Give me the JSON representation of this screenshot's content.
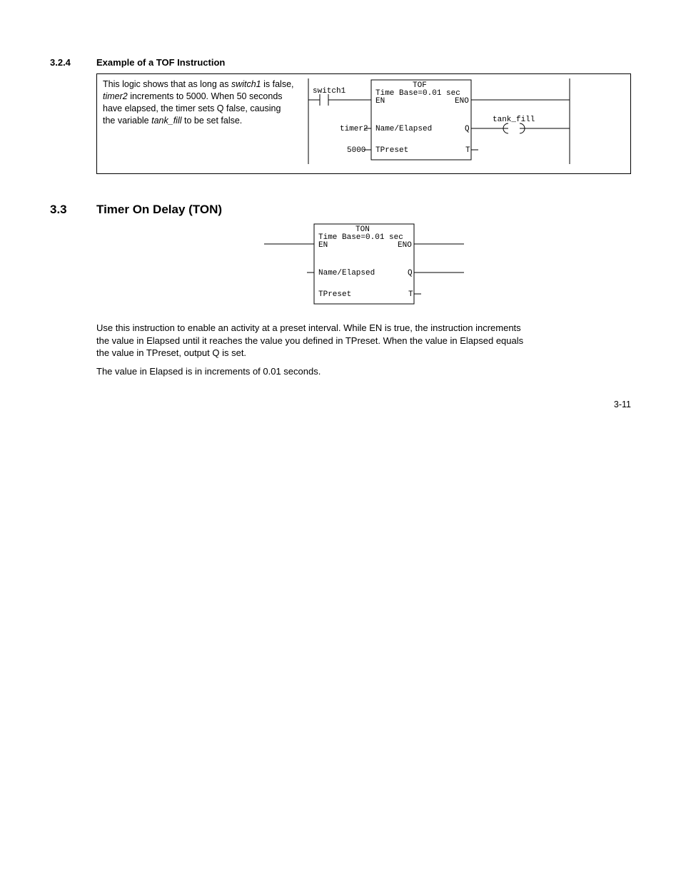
{
  "sec324": {
    "num": "3.2.4",
    "title": "Example of a TOF Instruction",
    "example": {
      "t1": "This logic shows that as long as ",
      "i1": "switch1",
      "t2": " is false, ",
      "i2": "timer2",
      "t3": " increments to 5000. When 50 seconds have elapsed, the timer sets Q false, causing the variable ",
      "i3": "tank_fill",
      "t4": " to be set false."
    },
    "diagram": {
      "block_title": "TOF",
      "time_base": "Time Base=0.01 sec",
      "en": "EN",
      "eno": "ENO",
      "switch": "switch1",
      "timer": "timer2",
      "name_elapsed": "Name/Elapsed",
      "q": "Q",
      "preset_val": "5000",
      "tpreset": "TPreset",
      "t": "T",
      "coil": "tank_fill"
    }
  },
  "sec33": {
    "num": "3.3",
    "title": "Timer On Delay (TON)",
    "diagram": {
      "block_title": "TON",
      "time_base": "Time Base=0.01 sec",
      "en": "EN",
      "eno": "ENO",
      "name_elapsed": "Name/Elapsed",
      "q": "Q",
      "tpreset": "TPreset",
      "t": "T"
    },
    "p1": "Use this instruction to enable an activity at a preset interval. While EN is true, the instruction increments the value in Elapsed until it reaches the value you defined in TPreset. When the value in Elapsed equals the value in TPreset, output Q is set.",
    "p2": "The value in Elapsed is in increments of 0.01 seconds."
  },
  "page_num": "3-11"
}
